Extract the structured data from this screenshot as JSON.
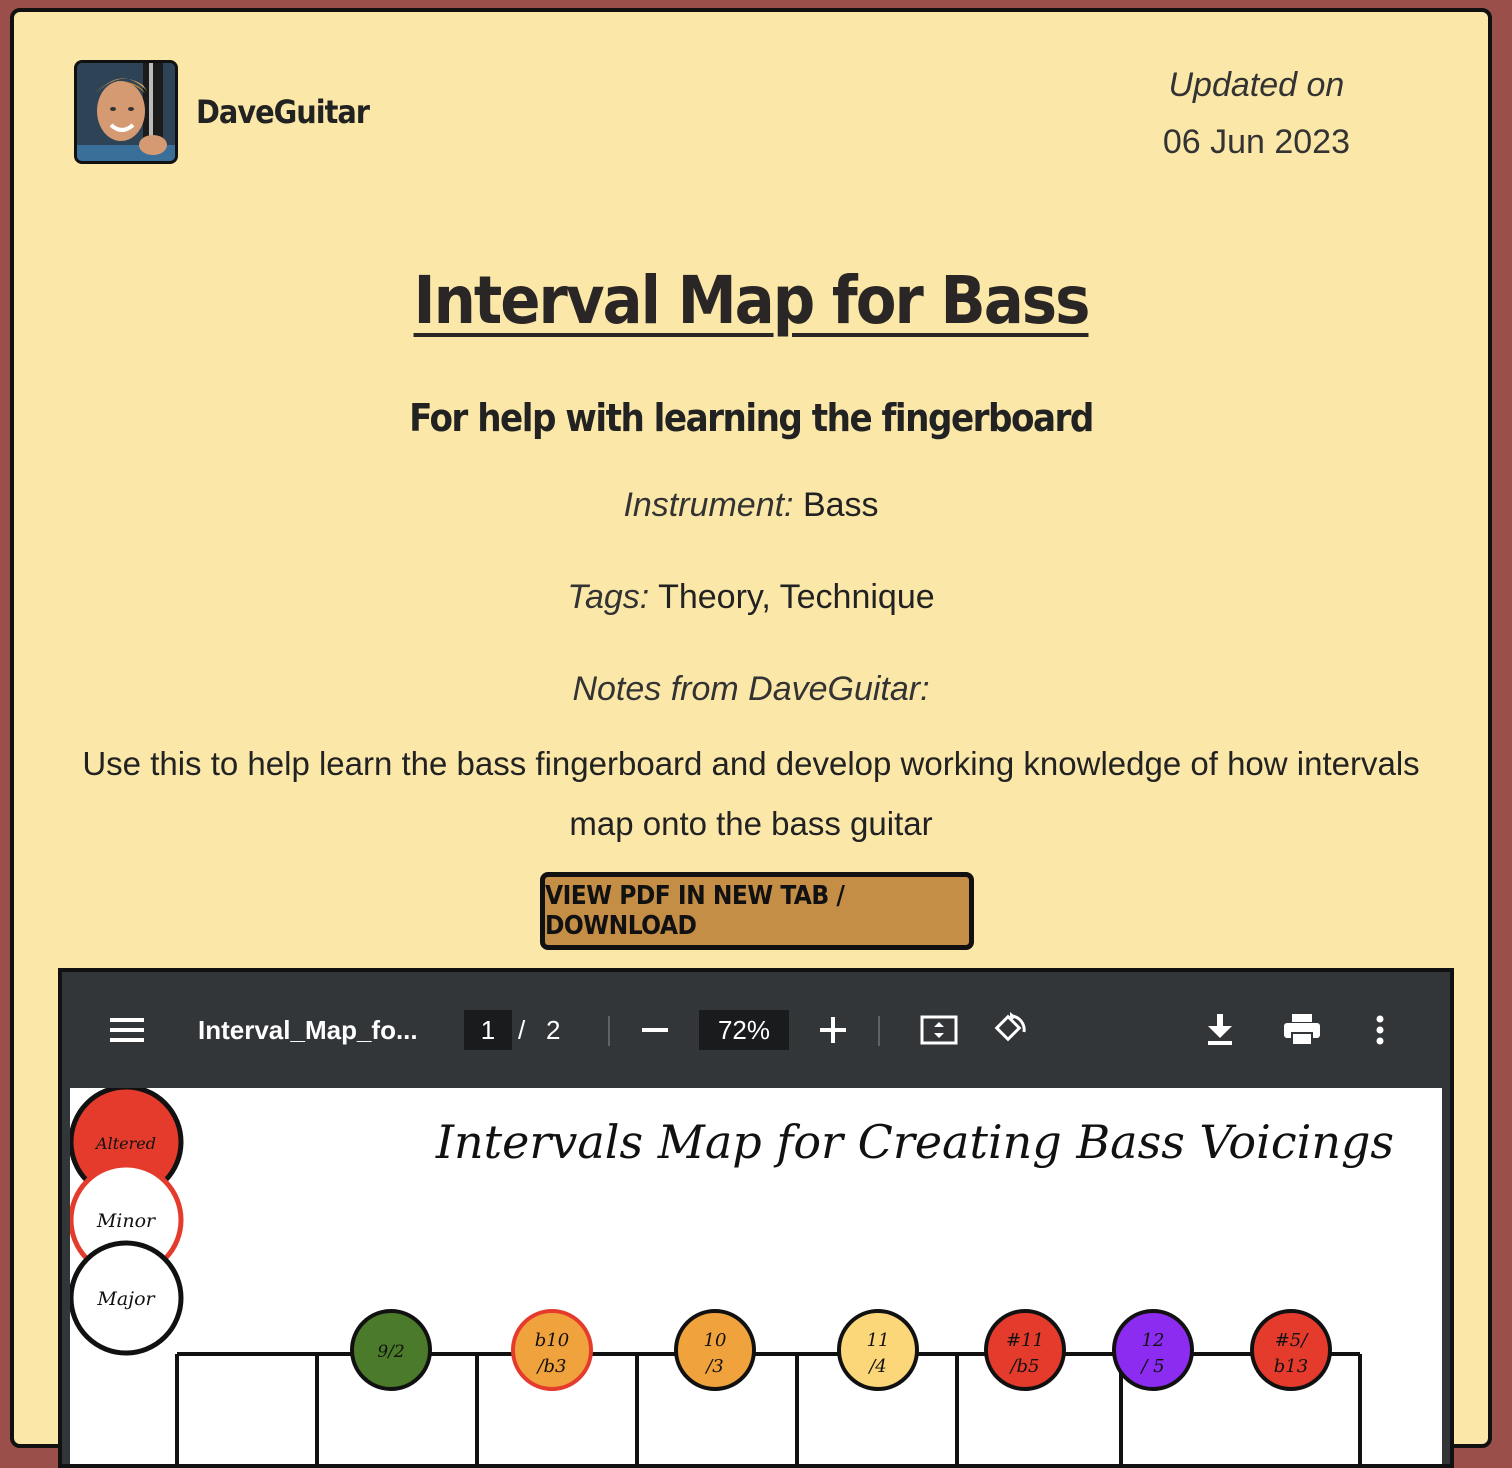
{
  "author": {
    "name": "DaveGuitar"
  },
  "updated": {
    "label": "Updated on",
    "date": "06 Jun 2023"
  },
  "page": {
    "title": "Interval Map for Bass",
    "subtitle": "For help with learning the fingerboard"
  },
  "meta": {
    "instrument_label": "Instrument:",
    "instrument_value": "Bass",
    "tags_label": "Tags:",
    "tags_value": "Theory, Technique",
    "notes_label": "Notes from DaveGuitar:",
    "notes_text": "Use this to help learn the bass fingerboard and develop working knowledge of how intervals map onto the bass guitar"
  },
  "download_button": {
    "label": "VIEW PDF IN NEW TAB / DOWNLOAD"
  },
  "pdf_viewer": {
    "filename": "Interval_Map_fo...",
    "current_page": "1",
    "page_separator": "/",
    "total_pages": "2",
    "zoom": "72%",
    "icons": [
      "menu-icon",
      "zoom-out-icon",
      "zoom-in-icon",
      "fit-page-icon",
      "rotate-icon",
      "download-icon",
      "print-icon",
      "more-options-icon"
    ]
  },
  "pdf_content": {
    "heading": "Intervals Map for Creating Bass Voicings",
    "legend": [
      {
        "label": "Altered",
        "fill": "#e53b2c",
        "stroke": "#111111"
      },
      {
        "label": "Minor",
        "fill": "#ffffff",
        "stroke": "#e53b2c"
      },
      {
        "label": "Major",
        "fill": "#ffffff",
        "stroke": "#111111"
      }
    ],
    "interval_markers": [
      {
        "line1": "9/2",
        "line2": "",
        "fill": "#4a7a2a",
        "stroke": "#111111"
      },
      {
        "line1": "b10",
        "line2": "/b3",
        "fill": "#f0a23c",
        "stroke": "#e53b2c"
      },
      {
        "line1": "10",
        "line2": "/3",
        "fill": "#f0a23c",
        "stroke": "#111111"
      },
      {
        "line1": "11",
        "line2": "/4",
        "fill": "#fbd77a",
        "stroke": "#111111"
      },
      {
        "line1": "#11",
        "line2": "/b5",
        "fill": "#e53b2c",
        "stroke": "#111111"
      },
      {
        "line1": "12",
        "line2": "/ 5",
        "fill": "#8b2cf0",
        "stroke": "#111111"
      },
      {
        "line1": "#5/",
        "line2": "b13",
        "fill": "#e53b2c",
        "stroke": "#111111"
      }
    ]
  }
}
